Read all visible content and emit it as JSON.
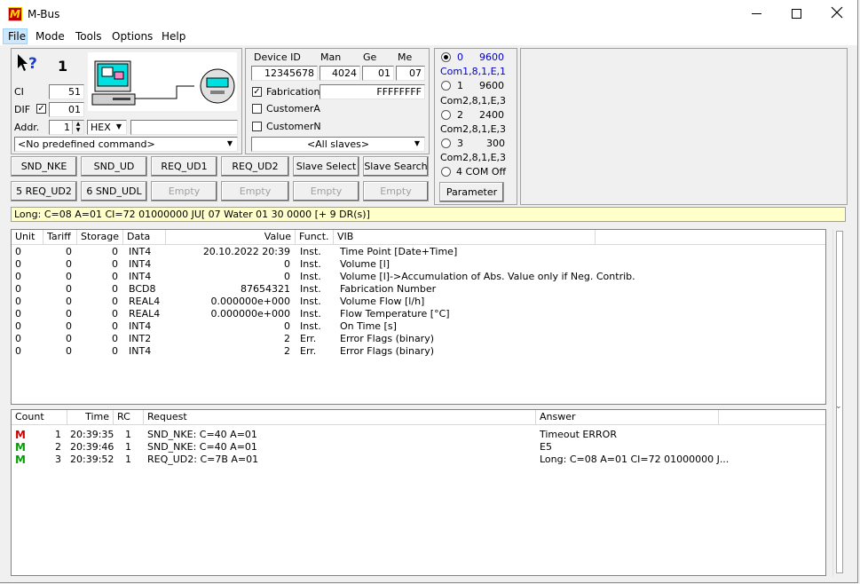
{
  "window": {
    "title": "M-Bus",
    "logo_letter": "M"
  },
  "menu": [
    "File",
    "Mode",
    "Tools",
    "Options",
    "Help"
  ],
  "left_panel": {
    "counter": "1",
    "ci_label": "CI",
    "ci_value": "51",
    "dif_label": "DIF",
    "dif_value": "01",
    "addr_label": "Addr.",
    "addr_value": "1",
    "format": "HEX",
    "command": "<No predefined command>"
  },
  "device_panel": {
    "headers": {
      "id": "Device ID",
      "man": "Man",
      "ge": "Ge",
      "me": "Me"
    },
    "device_id": "12345678",
    "man": "4024",
    "ge": "01",
    "me": "07",
    "fabrication_label": "Fabrication",
    "fabrication_value": "FFFFFFFF",
    "customer_a": "CustomerA",
    "customer_n": "CustomerN",
    "slaves": "<All slaves>"
  },
  "com_panel": {
    "ports": [
      {
        "num": "0",
        "baud": "9600",
        "settings": "Com1,8,1,E,1"
      },
      {
        "num": "1",
        "baud": "9600",
        "settings": "Com2,8,1,E,3"
      },
      {
        "num": "2",
        "baud": "2400",
        "settings": "Com2,8,1,E,3"
      },
      {
        "num": "3",
        "baud": "300",
        "settings": "Com2,8,1,E,3"
      }
    ],
    "off_label": "4 COM Off",
    "parameter_label": "Parameter"
  },
  "buttons_row1": [
    "SND_NKE",
    "SND_UD",
    "REQ_UD1",
    "REQ_UD2",
    "Slave Select",
    "Slave Search"
  ],
  "buttons_row2": [
    "5 REQ_UD2",
    "6 SND_UDL",
    "Empty",
    "Empty",
    "Empty",
    "Empty"
  ],
  "status_line": "Long:  C=08  A=01  CI=72  01000000  JU[  07  Water  01  30  0000  [+ 9 DR(s)]",
  "data_table": {
    "headers": [
      "Unit",
      "Tariff",
      "Storage",
      "Data",
      "Value",
      "Funct.",
      "VIB"
    ],
    "rows": [
      [
        "0",
        "0",
        "0",
        "INT4",
        "20.10.2022 20:39",
        "Inst.",
        "Time Point [Date+Time]"
      ],
      [
        "0",
        "0",
        "0",
        "INT4",
        "0",
        "Inst.",
        "Volume [l]"
      ],
      [
        "0",
        "0",
        "0",
        "INT4",
        "0",
        "Inst.",
        "Volume [l]->Accumulation of Abs. Value only if Neg. Contrib."
      ],
      [
        "0",
        "0",
        "0",
        "BCD8",
        "87654321",
        "Inst.",
        "Fabrication Number"
      ],
      [
        "0",
        "0",
        "0",
        "REAL4",
        "0.000000e+000",
        "Inst.",
        "Volume Flow [l/h]"
      ],
      [
        "0",
        "0",
        "0",
        "REAL4",
        "0.000000e+000",
        "Inst.",
        "Flow Temperature [°C]"
      ],
      [
        "0",
        "0",
        "0",
        "INT4",
        "0",
        "Inst.",
        "On Time [s]"
      ],
      [
        "0",
        "0",
        "0",
        "INT2",
        "2",
        "Err.",
        "Error Flags (binary)"
      ],
      [
        "0",
        "0",
        "0",
        "INT4",
        "2",
        "Err.",
        "Error Flags (binary)"
      ]
    ]
  },
  "log_table": {
    "headers": [
      "Count",
      "Time",
      "RC",
      "Request",
      "Answer"
    ],
    "rows": [
      {
        "icon": "M",
        "icon_color": "#d00000",
        "count": "1",
        "time": "20:39:35",
        "rc": "1",
        "request": "SND_NKE:  C=40  A=01",
        "answer": "Timeout ERROR"
      },
      {
        "icon": "M",
        "icon_color": "#00a000",
        "count": "2",
        "time": "20:39:46",
        "rc": "1",
        "request": "SND_NKE:  C=40  A=01",
        "answer": "E5"
      },
      {
        "icon": "M",
        "icon_color": "#00a000",
        "count": "3",
        "time": "20:39:52",
        "rc": "1",
        "request": "REQ_UD2: C=7B A=01",
        "answer": "Long:  C=08  A=01  CI=72  01000000  J..."
      }
    ]
  },
  "colors": {
    "status_bg": "#ffffcc",
    "com_blue": "#0000c0",
    "accent_logo": "#c00000"
  }
}
